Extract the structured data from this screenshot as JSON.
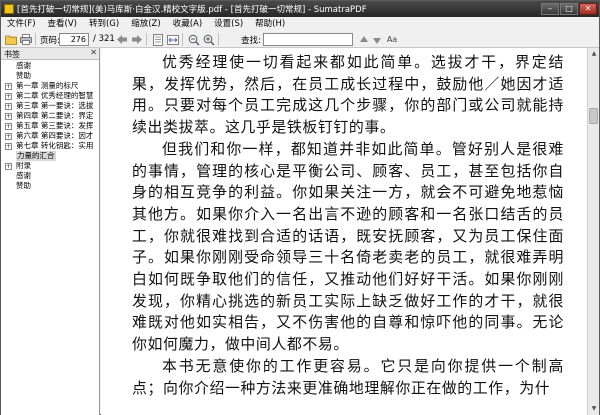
{
  "window": {
    "title": "[首先打破一切常规](美)马库斯·白金汉.精校文字版.pdf - [首先打破一切常规] - SumatraPDF"
  },
  "menu": {
    "items": [
      "文件(F)",
      "查看(V)",
      "转到(G)",
      "缩放(Z)",
      "收藏(A)",
      "设置(S)",
      "帮助(H)"
    ]
  },
  "toolbar": {
    "page_label": "页码:",
    "current_page": "276",
    "total_pages": "/ 321",
    "find_label": "查找:"
  },
  "sidebar": {
    "title": "书签",
    "items": [
      {
        "label": "感谢",
        "expandable": false
      },
      {
        "label": "赞助",
        "expandable": false
      },
      {
        "label": "第一章 测量的标尺",
        "expandable": true
      },
      {
        "label": "第二章 优秀经理的智慧",
        "expandable": true
      },
      {
        "label": "第三章 第一要诀：选拔",
        "expandable": true
      },
      {
        "label": "第四章 第二要诀：界定",
        "expandable": true
      },
      {
        "label": "第五章 第三要诀：发挥",
        "expandable": true
      },
      {
        "label": "第六章 第四要诀：因才",
        "expandable": true
      },
      {
        "label": "第七章 转化钥匙：实用",
        "expandable": true
      },
      {
        "label": "力量的汇合",
        "expandable": false,
        "selected": true
      },
      {
        "label": "附录",
        "expandable": true
      },
      {
        "label": "感谢",
        "expandable": false
      },
      {
        "label": "赞助",
        "expandable": false
      }
    ]
  },
  "document": {
    "paragraphs": [
      "优秀经理使一切看起来都如此简单。选拔才干，界定结果，发挥优势，然后，在员工成长过程中，鼓励他／她因才适用。只要对每个员工完成这几个步骤，你的部门或公司就能持续出类拔萃。这几乎是铁板钉钉的事。",
      "但我们和你一样，都知道并非如此简单。管好别人是很难的事情，管理的核心是平衡公司、顾客、员工，甚至包括你自身的相互竞争的利益。你如果关注一方，就会不可避免地惹恼其他方。如果你介入一名出言不逊的顾客和一名张口结舌的员工，你就很难找到合适的话语，既安抚顾客，又为员工保住面子。如果你刚刚受命领导三十名倚老卖老的员工，就很难弄明白如何既争取他们的信任，又推动他们好好干活。如果你刚刚发现，你精心挑选的新员工实际上缺乏做好工作的才干，就很难既对他如实相告，又不伤害他的自尊和惊吓他的同事。无论你如何魔力，做中间人都不易。",
      "本书无意使你的工作更容易。它只是向你提供一个制高点；向你介绍一种方法来更准确地理解你正在做的工作，为什"
    ]
  }
}
